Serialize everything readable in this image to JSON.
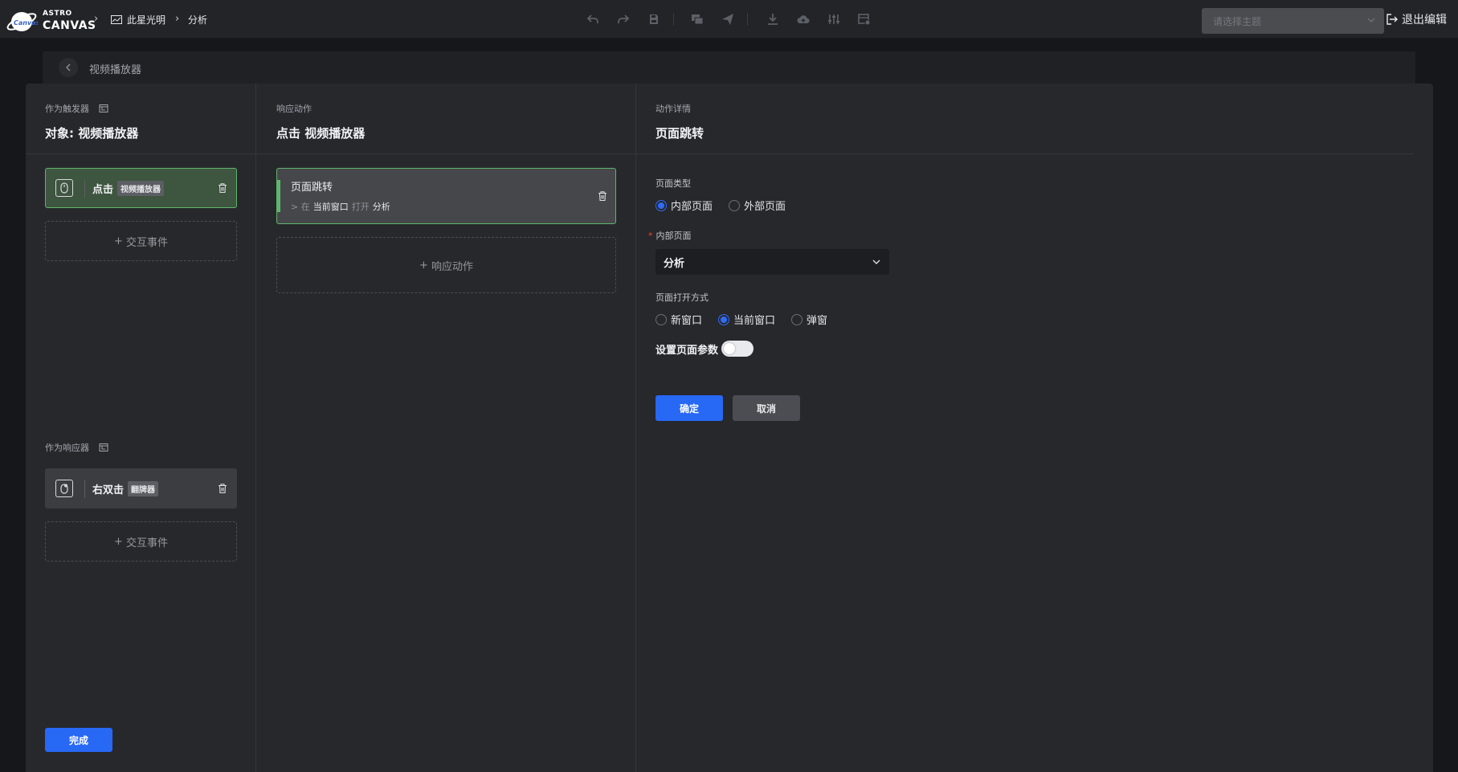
{
  "header": {
    "logo_top": "ASTRO",
    "logo_bottom": "CANVAS",
    "breadcrumb": [
      {
        "label": "此星光明",
        "icon": "dashboard-icon"
      },
      {
        "label": "分析"
      }
    ],
    "toolbar_icons": [
      "undo-icon",
      "redo-icon",
      "save-icon",
      "preview-icon",
      "publish-icon",
      "download-icon",
      "cloud-upload-icon",
      "adjust-icon",
      "settings-icon"
    ],
    "theme_placeholder": "请选择主题",
    "exit_label": "退出编辑"
  },
  "editor": {
    "back_title": "视频播放器"
  },
  "trigger": {
    "label": "作为触发器",
    "title": "对象: 视频播放器",
    "event": {
      "action": "点击",
      "target": "视频播放器"
    },
    "add_label": "交互事件"
  },
  "responder": {
    "label": "作为响应器",
    "event": {
      "action": "右双击",
      "target": "翻牌器"
    },
    "add_label": "交互事件",
    "done_label": "完成"
  },
  "response": {
    "label": "响应动作",
    "title": "点击 视频播放器",
    "action": {
      "title": "页面跳转",
      "prefix": "> 在",
      "window": "当前窗口",
      "verb": "打开",
      "page": "分析"
    },
    "add_label": "响应动作"
  },
  "detail": {
    "label": "动作详情",
    "title": "页面跳转",
    "page_type_label": "页面类型",
    "page_type_options": [
      "内部页面",
      "外部页面"
    ],
    "page_type_selected": 0,
    "internal_page_label": "内部页面",
    "internal_page_value": "分析",
    "open_mode_label": "页面打开方式",
    "open_mode_options": [
      "新窗口",
      "当前窗口",
      "弹窗"
    ],
    "open_mode_selected": 1,
    "params_label": "设置页面参数",
    "params_enabled": false,
    "confirm_label": "确定",
    "cancel_label": "取消"
  },
  "colors": {
    "accent": "#2768f5",
    "active_green": "#5fb56b",
    "panel_bg": "#27282c"
  }
}
